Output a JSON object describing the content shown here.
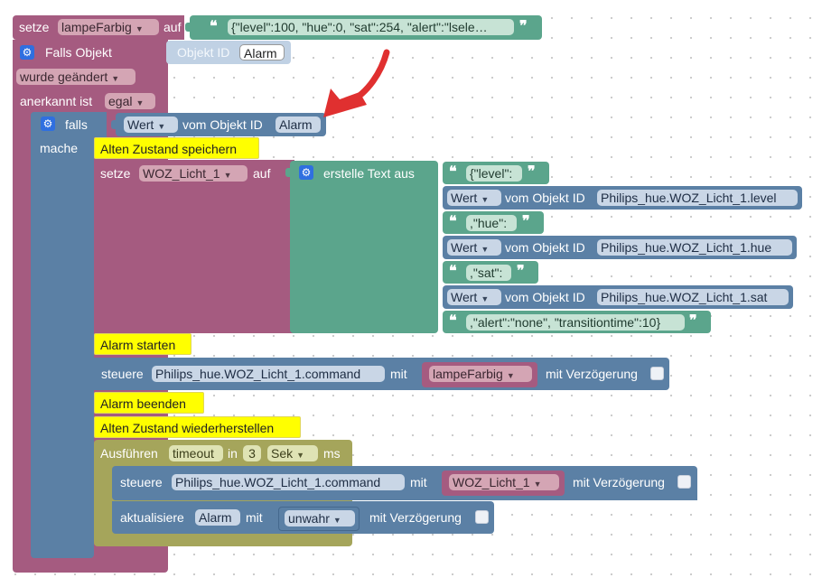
{
  "colors": {
    "magenta": "#a55b80",
    "blue": "#5b80a5",
    "teal": "#5ba58c",
    "olive": "#a5a55b",
    "comment": "#ffff00",
    "annotation_arrow": "#e03030"
  },
  "setze_top": {
    "setze": "setze",
    "variable": "lampeFarbig",
    "auf": "auf",
    "json": "{\"level\":100, \"hue\":0, \"sat\":254, \"alert\":\"lsele…"
  },
  "trigger": {
    "falls_objekt": "Falls Objekt",
    "objekt_id_label": "Objekt ID",
    "objekt_id": "Alarm",
    "change": "wurde geändert",
    "anerkannt_label": "anerkannt ist",
    "anerkannt_value": "egal"
  },
  "if_block": {
    "falls": "falls",
    "wert": "Wert",
    "vom_objekt_id": "vom Objekt ID",
    "objekt": "Alarm",
    "mache": "mache"
  },
  "comments": {
    "save_state": "Alten Zustand speichern",
    "alarm_start": "Alarm starten",
    "alarm_end": "Alarm beenden",
    "restore_state": "Alten Zustand wiederherstellen"
  },
  "setze_woz": {
    "setze": "setze",
    "variable": "WOZ_Licht_1",
    "auf": "auf",
    "erstelle_text_aus": "erstelle Text aus",
    "items": [
      {
        "kind": "text",
        "value": "{\"level\":"
      },
      {
        "kind": "wert",
        "wert": "Wert",
        "vom": "vom Objekt ID",
        "id": "Philips_hue.WOZ_Licht_1.level"
      },
      {
        "kind": "text",
        "value": ",\"hue\":"
      },
      {
        "kind": "wert",
        "wert": "Wert",
        "vom": "vom Objekt ID",
        "id": "Philips_hue.WOZ_Licht_1.hue"
      },
      {
        "kind": "text",
        "value": ",\"sat\":"
      },
      {
        "kind": "wert",
        "wert": "Wert",
        "vom": "vom Objekt ID",
        "id": "Philips_hue.WOZ_Licht_1.sat"
      },
      {
        "kind": "text",
        "value": ",\"alert\":\"none\", \"transitiontime\":10}"
      }
    ]
  },
  "steuere_1": {
    "steuere": "steuere",
    "object": "Philips_hue.WOZ_Licht_1.command",
    "mit": "mit",
    "value": "lampeFarbig",
    "mit_verzoegerung": "mit Verzögerung"
  },
  "timeout": {
    "ausfuehren": "Ausführen",
    "timeout": "timeout",
    "in": "in",
    "amount": "3",
    "unit": "Sek",
    "ms": "ms"
  },
  "steuere_2": {
    "steuere": "steuere",
    "object": "Philips_hue.WOZ_Licht_1.command",
    "mit": "mit",
    "value": "WOZ_Licht_1",
    "mit_verzoegerung": "mit Verzögerung"
  },
  "aktualisiere": {
    "label": "aktualisiere",
    "object": "Alarm",
    "mit": "mit",
    "value": "unwahr",
    "mit_verzoegerung": "mit Verzögerung"
  },
  "icons": {
    "gear": "gear-icon",
    "dropdown": "dropdown-arrow-icon",
    "quote_open": "quote-open-icon",
    "quote_close": "quote-close-icon"
  },
  "glyphs": {
    "dropdown": "▼",
    "quote_open": "❝",
    "quote_close": "❞",
    "gear": "⚙"
  }
}
